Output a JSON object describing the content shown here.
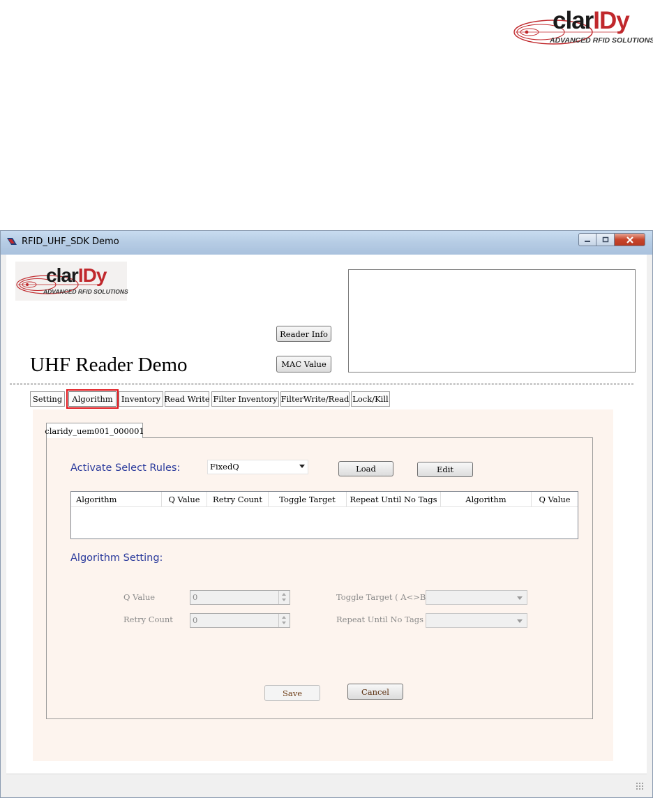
{
  "brand": {
    "name_prefix": "clar",
    "name_suffix": "IDy",
    "tagline": "ADVANCED RFID SOLUTIONS",
    "accent_color": "#c0282c"
  },
  "window": {
    "title": "RFID_UHF_SDK Demo",
    "app_icon": "rfid-app-icon",
    "controls": {
      "minimize": "minimize-icon",
      "maximize": "maximize-icon",
      "close": "close-icon"
    }
  },
  "header": {
    "reader_info_label": "Reader Info",
    "mac_value_label": "MAC Value",
    "app_title": "UHF Reader Demo"
  },
  "tabs": [
    {
      "label": "Setting"
    },
    {
      "label": "Algorithm",
      "active": true
    },
    {
      "label": "Inventory"
    },
    {
      "label": "Read Write"
    },
    {
      "label": "Filter Inventory"
    },
    {
      "label": "FilterWrite/Read"
    },
    {
      "label": "Lock/Kill"
    }
  ],
  "device_tab": {
    "label": "claridy_uem001_000001"
  },
  "select_rules": {
    "label": "Activate Select Rules:",
    "selected": "FixedQ",
    "load_label": "Load",
    "edit_label": "Edit"
  },
  "grid": {
    "columns": [
      "Algorithm",
      "Q Value",
      "Retry Count",
      "Toggle Target",
      "Repeat Until No Tags",
      "Algorithm",
      "Q Value"
    ]
  },
  "algorithm_setting": {
    "label": "Algorithm Setting:",
    "q_value_label": "Q Value",
    "q_value": "0",
    "retry_count_label": "Retry Count",
    "retry_count": "0",
    "toggle_target_label": "Toggle Target ( A<>B )",
    "repeat_label": "Repeat Until No Tags",
    "save_label": "Save",
    "cancel_label": "Cancel"
  }
}
